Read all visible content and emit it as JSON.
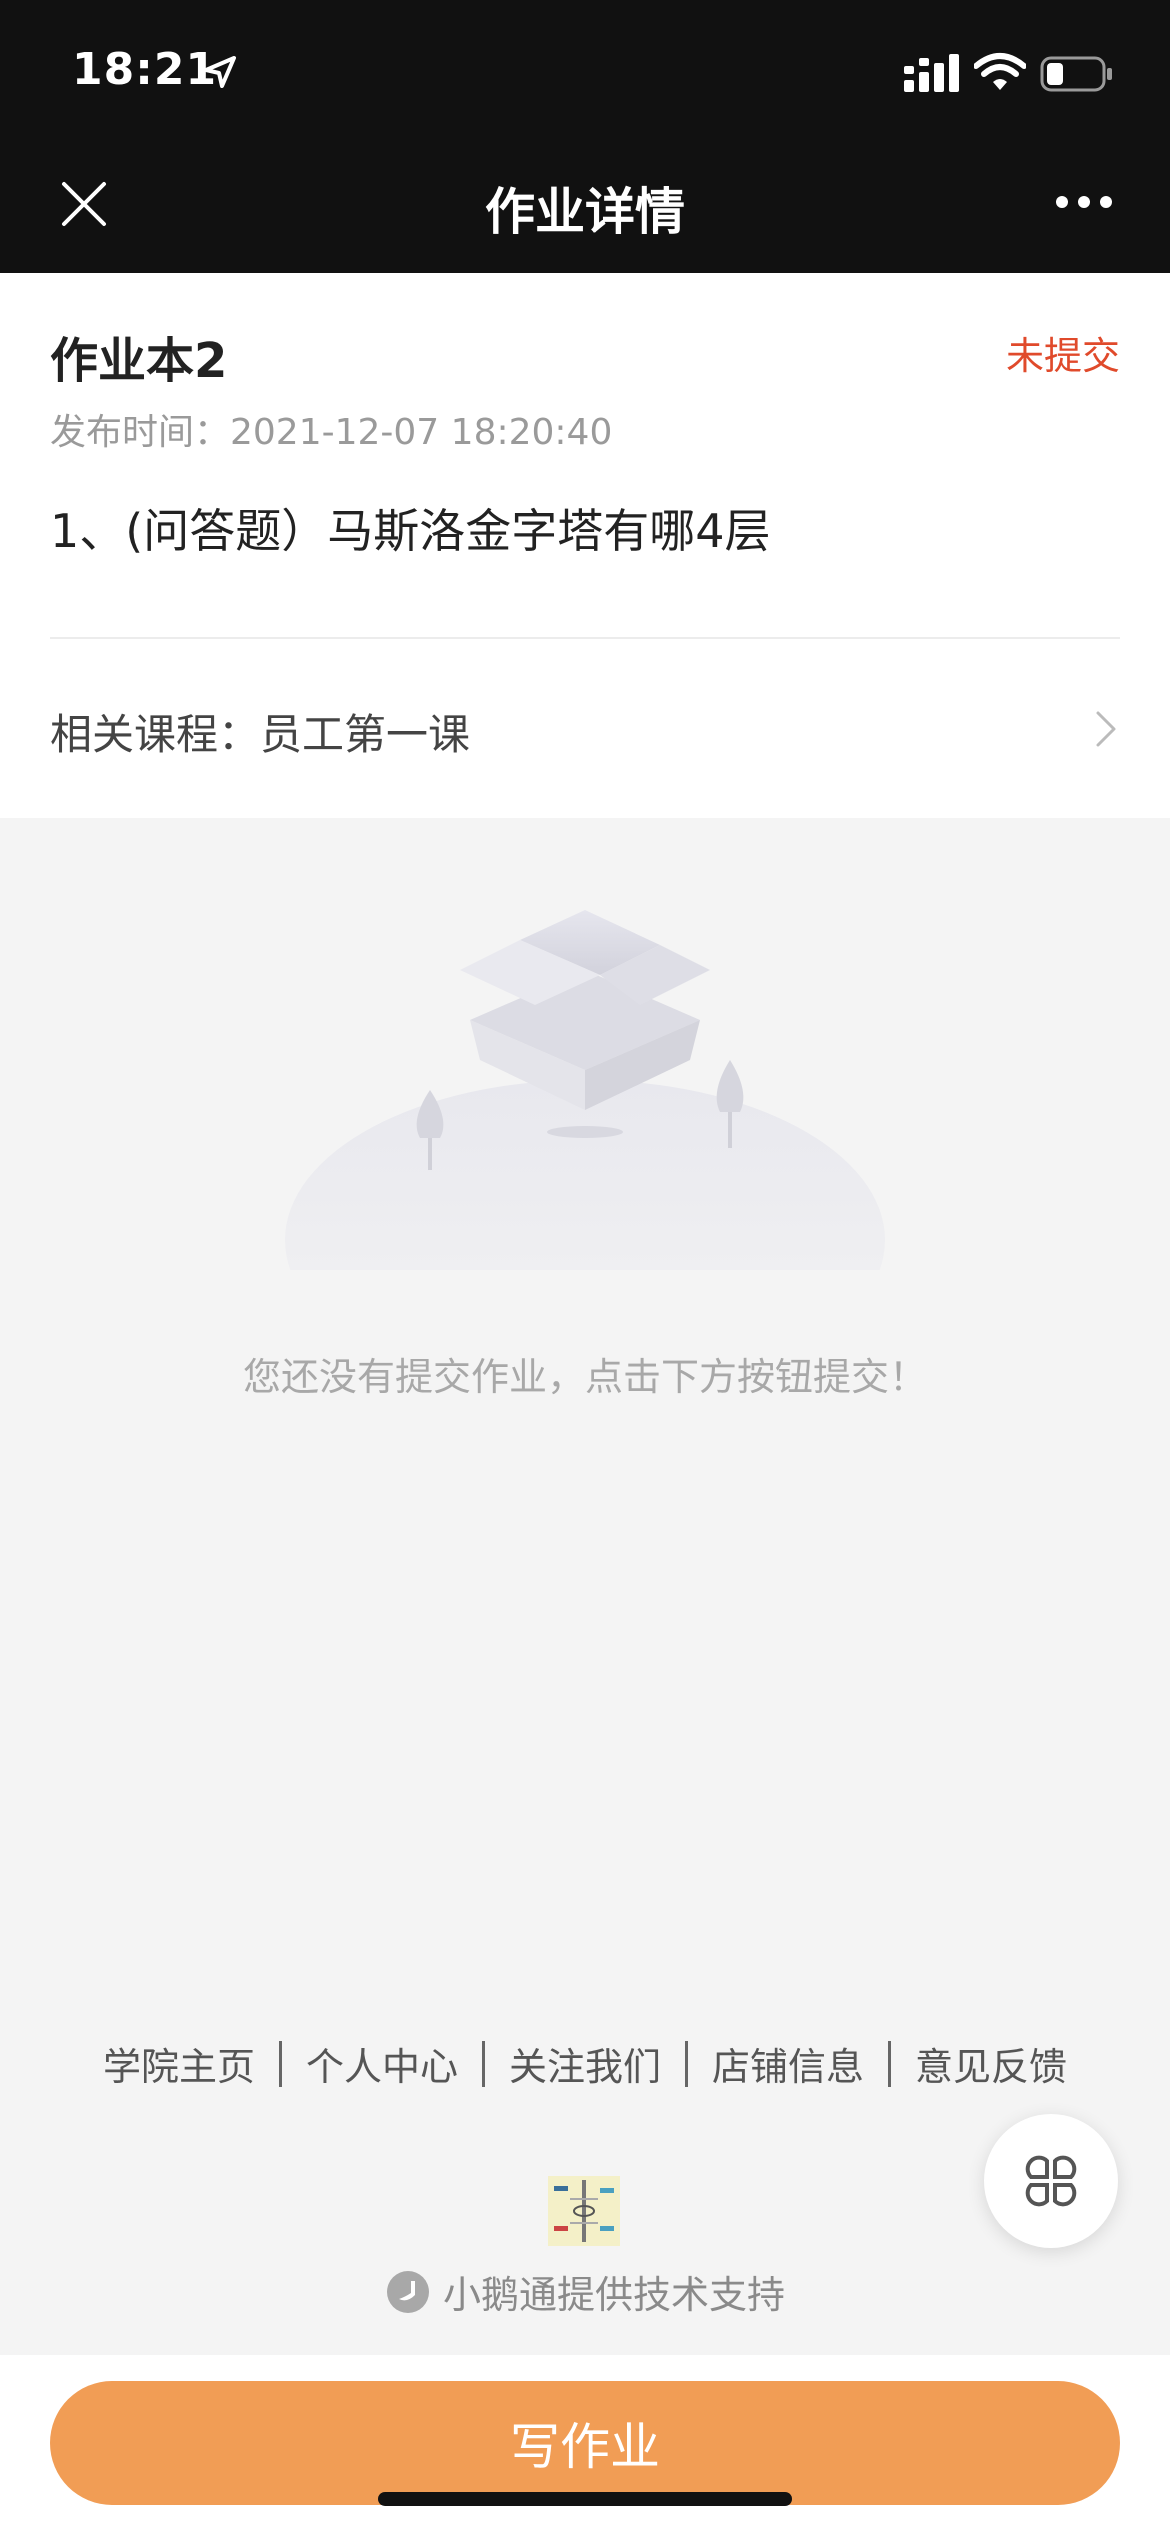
{
  "status_bar": {
    "time": "18:21",
    "icons": [
      "location-arrow-icon",
      "signal-icon",
      "wifi-icon",
      "battery-icon"
    ]
  },
  "nav": {
    "title": "作业详情",
    "left_icon": "close-icon",
    "right_icon": "more-icon"
  },
  "homework": {
    "title": "作业本2",
    "status": "未提交",
    "publish_time": "发布时间：2021-12-07 18:20:40",
    "question": "1、(问答题）马斯洛金字塔有哪4层",
    "related_course": "相关课程：员工第一课"
  },
  "empty_state": {
    "message": "您还没有提交作业，点击下方按钮提交！"
  },
  "footer": {
    "links": [
      "学院主页",
      "个人中心",
      "关注我们",
      "店铺信息",
      "意见反馈"
    ],
    "support_text": "小鹅通提供技术支持"
  },
  "action": {
    "write_label": "写作业"
  },
  "colors": {
    "status_red": "#e04a2b",
    "primary_orange": "#f19d55",
    "top_bar": "#111111",
    "page_bg": "#f4f4f4"
  }
}
